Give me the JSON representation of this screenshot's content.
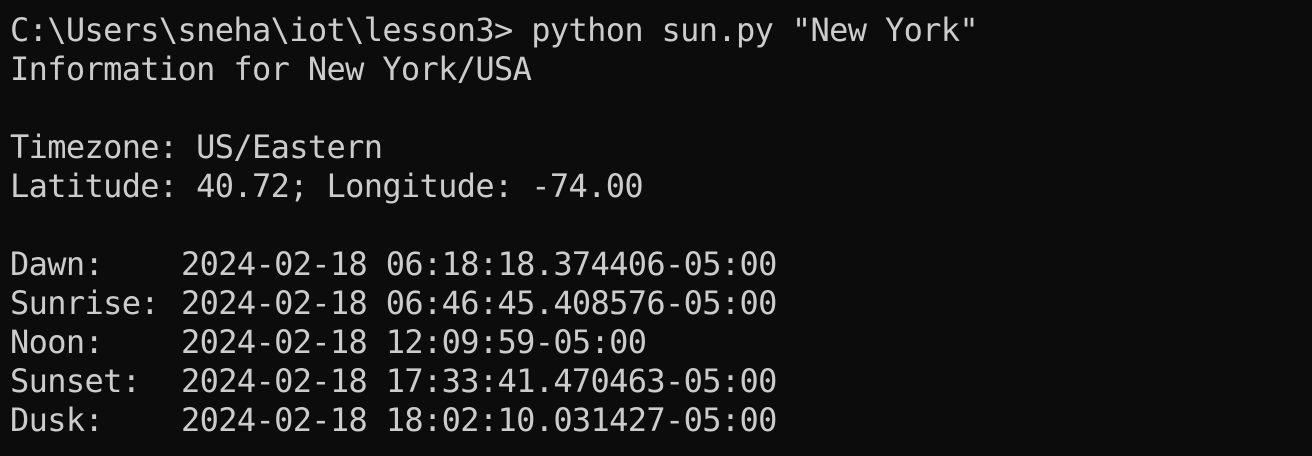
{
  "terminal": {
    "prompt": "C:\\Users\\sneha\\iot\\lesson3> ",
    "command": "python sun.py \"New York\"",
    "info_line": "Information for New York/USA",
    "timezone_line": "Timezone: US/Eastern",
    "latlon_line": "Latitude: 40.72; Longitude: -74.00",
    "events": [
      {
        "label": "Dawn:",
        "value": "2024-02-18 06:18:18.374406-05:00"
      },
      {
        "label": "Sunrise:",
        "value": "2024-02-18 06:46:45.408576-05:00"
      },
      {
        "label": "Noon:",
        "value": "2024-02-18 12:09:59-05:00"
      },
      {
        "label": "Sunset:",
        "value": "2024-02-18 17:33:41.470463-05:00"
      },
      {
        "label": "Dusk:",
        "value": "2024-02-18 18:02:10.031427-05:00"
      }
    ]
  },
  "colors": {
    "background": "#0c0c0c",
    "foreground": "#cccccc"
  }
}
